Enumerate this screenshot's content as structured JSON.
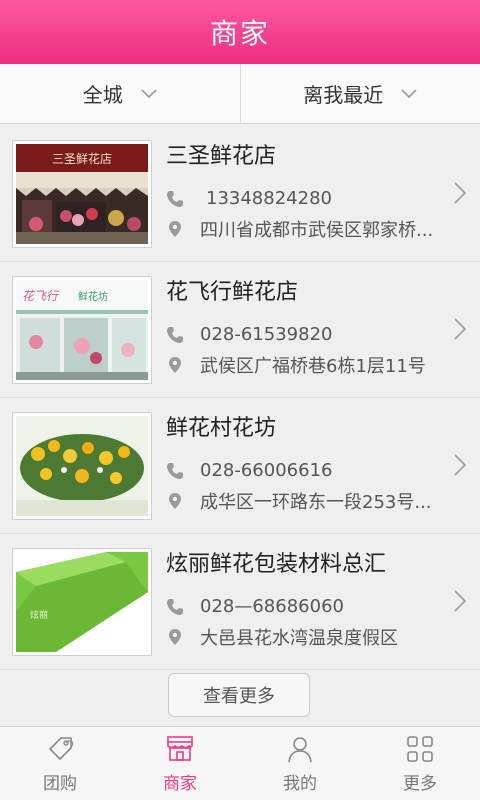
{
  "header": {
    "title": "商家"
  },
  "filters": [
    {
      "label": "全城",
      "icon": "chevron-down-icon"
    },
    {
      "label": "离我最近",
      "icon": "chevron-down-icon"
    }
  ],
  "shops": [
    {
      "name": "三圣鲜花店",
      "phone": "13348824280",
      "address": "四川省成都市武侯区郭家桥...",
      "sign_text": "三圣鲜花店"
    },
    {
      "name": "花飞行鲜花店",
      "phone": "028-61539820",
      "address": "武侯区广福桥巷6栋1层11号",
      "sign_text": "鲜花坊"
    },
    {
      "name": "鲜花村花坊",
      "phone": "028-66006616",
      "address": "成华区一环路东一段253号..."
    },
    {
      "name": "炫丽鲜花包装材料总汇",
      "phone": "028—68686060",
      "address": "大邑县花水湾温泉度假区"
    }
  ],
  "more_button": {
    "label": "查看更多"
  },
  "tabs": [
    {
      "label": "团购",
      "icon": "tag-icon"
    },
    {
      "label": "商家",
      "icon": "shop-icon",
      "active": true
    },
    {
      "label": "我的",
      "icon": "user-icon"
    },
    {
      "label": "更多",
      "icon": "grid-icon"
    }
  ],
  "colors": {
    "accent": "#ee3a86",
    "header": "#ff4f98"
  }
}
